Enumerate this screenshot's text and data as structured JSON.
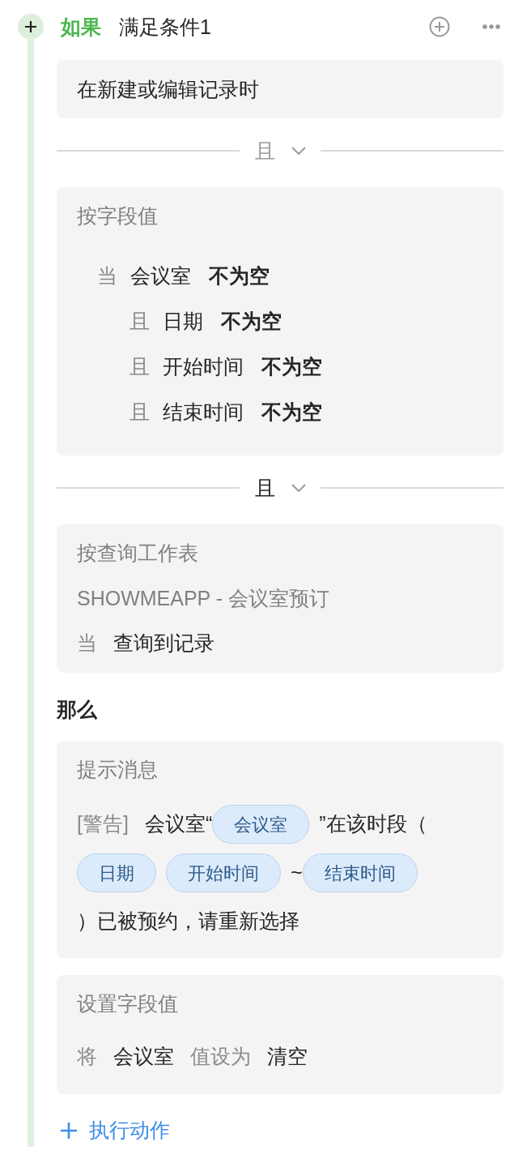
{
  "header": {
    "keyword": "如果",
    "title": "满足条件1"
  },
  "trigger": {
    "text": "在新建或编辑记录时"
  },
  "blocks": [
    {
      "kind": "divider",
      "connector": "且",
      "disabled": true
    },
    {
      "kind": "field_conditions",
      "title": "按字段值",
      "conditions": [
        {
          "keyword": "当",
          "field": "会议室",
          "operator": "不为空",
          "children": [
            {
              "keyword": "且",
              "field": "日期",
              "operator": "不为空"
            },
            {
              "keyword": "且",
              "field": "开始时间",
              "operator": "不为空"
            },
            {
              "keyword": "且",
              "field": "结束时间",
              "operator": "不为空"
            }
          ]
        }
      ]
    },
    {
      "kind": "divider",
      "connector": "且",
      "disabled": false
    },
    {
      "kind": "query",
      "title": "按查询工作表",
      "sheet": "SHOWMEAPP - 会议室预订",
      "keyword": "当",
      "condition": "查询到记录"
    }
  ],
  "then": {
    "heading": "那么",
    "actions": [
      {
        "kind": "message",
        "title": "提示消息",
        "lines": [
          [
            {
              "kind": "label",
              "text": "[警告]"
            },
            {
              "kind": "text",
              "text": "会议室“"
            },
            {
              "kind": "field",
              "text": "会议室"
            },
            {
              "kind": "text",
              "text": "”在该时段（"
            }
          ],
          [
            {
              "kind": "field",
              "text": "日期"
            },
            {
              "kind": "field",
              "text": "开始时间"
            },
            {
              "kind": "text",
              "text": "~"
            },
            {
              "kind": "field",
              "text": "结束时间"
            }
          ],
          [
            {
              "kind": "text",
              "text": "）已被预约，请重新选择"
            }
          ]
        ]
      },
      {
        "kind": "set_field",
        "title": "设置字段值",
        "parts": [
          {
            "kind": "label",
            "text": "将"
          },
          {
            "kind": "field",
            "text": "会议室"
          },
          {
            "kind": "label",
            "text": "值设为"
          },
          {
            "kind": "value",
            "text": "清空"
          }
        ]
      }
    ],
    "add_action": {
      "label": "执行动作"
    }
  }
}
